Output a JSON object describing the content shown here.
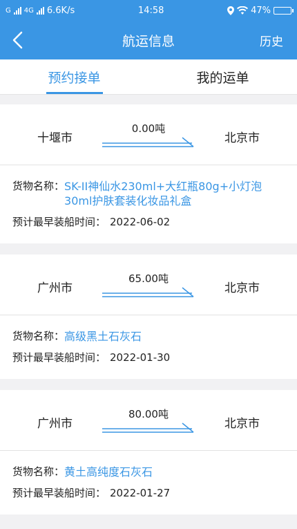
{
  "status_bar": {
    "network": "G",
    "network2": "4G",
    "speed": "6.6K/s",
    "time": "14:58",
    "battery": "47%",
    "battery_level": 0.47
  },
  "navbar": {
    "title": "航运信息",
    "right": "历史"
  },
  "tabs": [
    {
      "label": "预约接单",
      "active": true
    },
    {
      "label": "我的运单",
      "active": false
    }
  ],
  "labels": {
    "cargo": "货物名称：",
    "date": "预计最早装船时间："
  },
  "shipments": [
    {
      "from": "十堰市",
      "to": "北京市",
      "weight": "0.00吨",
      "cargo": "SK-II神仙水230ml+大红瓶80g+小灯泡30ml护肤套装化妆品礼盒",
      "date": "2022-06-02"
    },
    {
      "from": "广州市",
      "to": "北京市",
      "weight": "65.00吨",
      "cargo": "高级黑土石灰石",
      "date": "2022-01-30"
    },
    {
      "from": "广州市",
      "to": "北京市",
      "weight": "80.00吨",
      "cargo": "黄土高纯度石灰石",
      "date": "2022-01-27"
    }
  ],
  "colors": {
    "accent": "#3a96e4"
  }
}
